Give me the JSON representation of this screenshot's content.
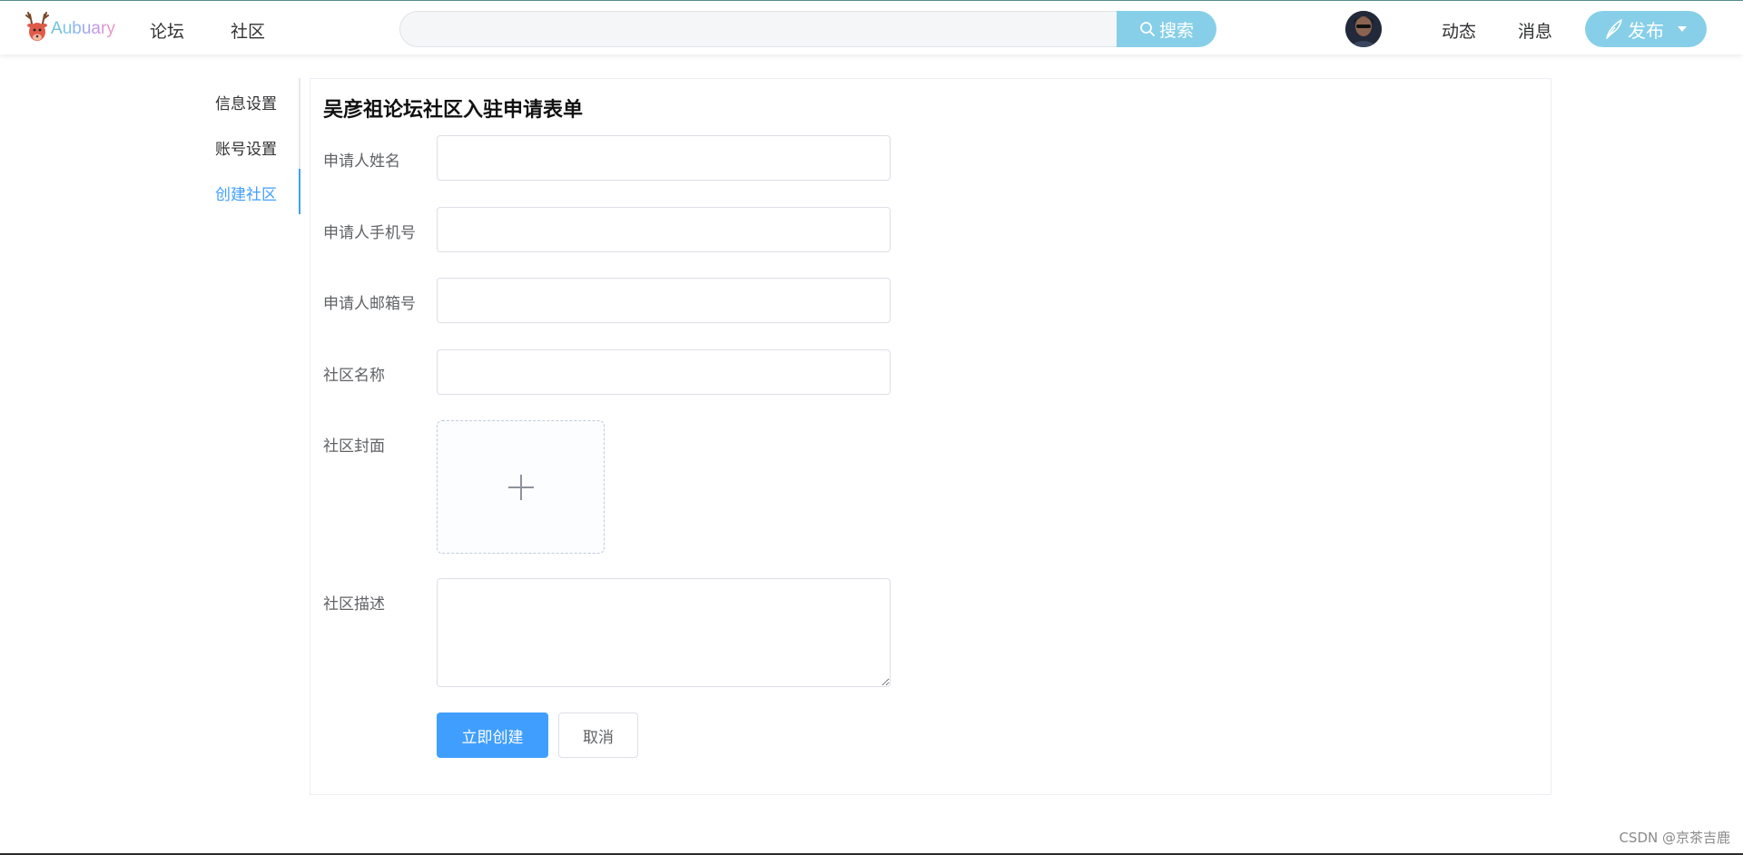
{
  "header": {
    "logo_text": "Aubuary",
    "nav": [
      "论坛",
      "社区"
    ],
    "search": {
      "placeholder": "",
      "button_label": "搜索"
    },
    "right_links": [
      "动态",
      "消息"
    ],
    "publish_label": "发布"
  },
  "sidebar": {
    "items": [
      {
        "label": "信息设置",
        "active": false
      },
      {
        "label": "账号设置",
        "active": false
      },
      {
        "label": "创建社区",
        "active": true
      }
    ]
  },
  "form": {
    "title": "吴彦祖论坛社区入驻申请表单",
    "fields": [
      {
        "label": "申请人姓名",
        "value": ""
      },
      {
        "label": "申请人手机号",
        "value": ""
      },
      {
        "label": "申请人邮箱号",
        "value": ""
      },
      {
        "label": "社区名称",
        "value": ""
      }
    ],
    "cover_label": "社区封面",
    "description_label": "社区描述",
    "description_value": "",
    "submit_label": "立即创建",
    "cancel_label": "取消"
  },
  "watermark": "CSDN @京茶吉鹿",
  "colors": {
    "accent": "#409eff",
    "header_button": "#87cfe8"
  }
}
